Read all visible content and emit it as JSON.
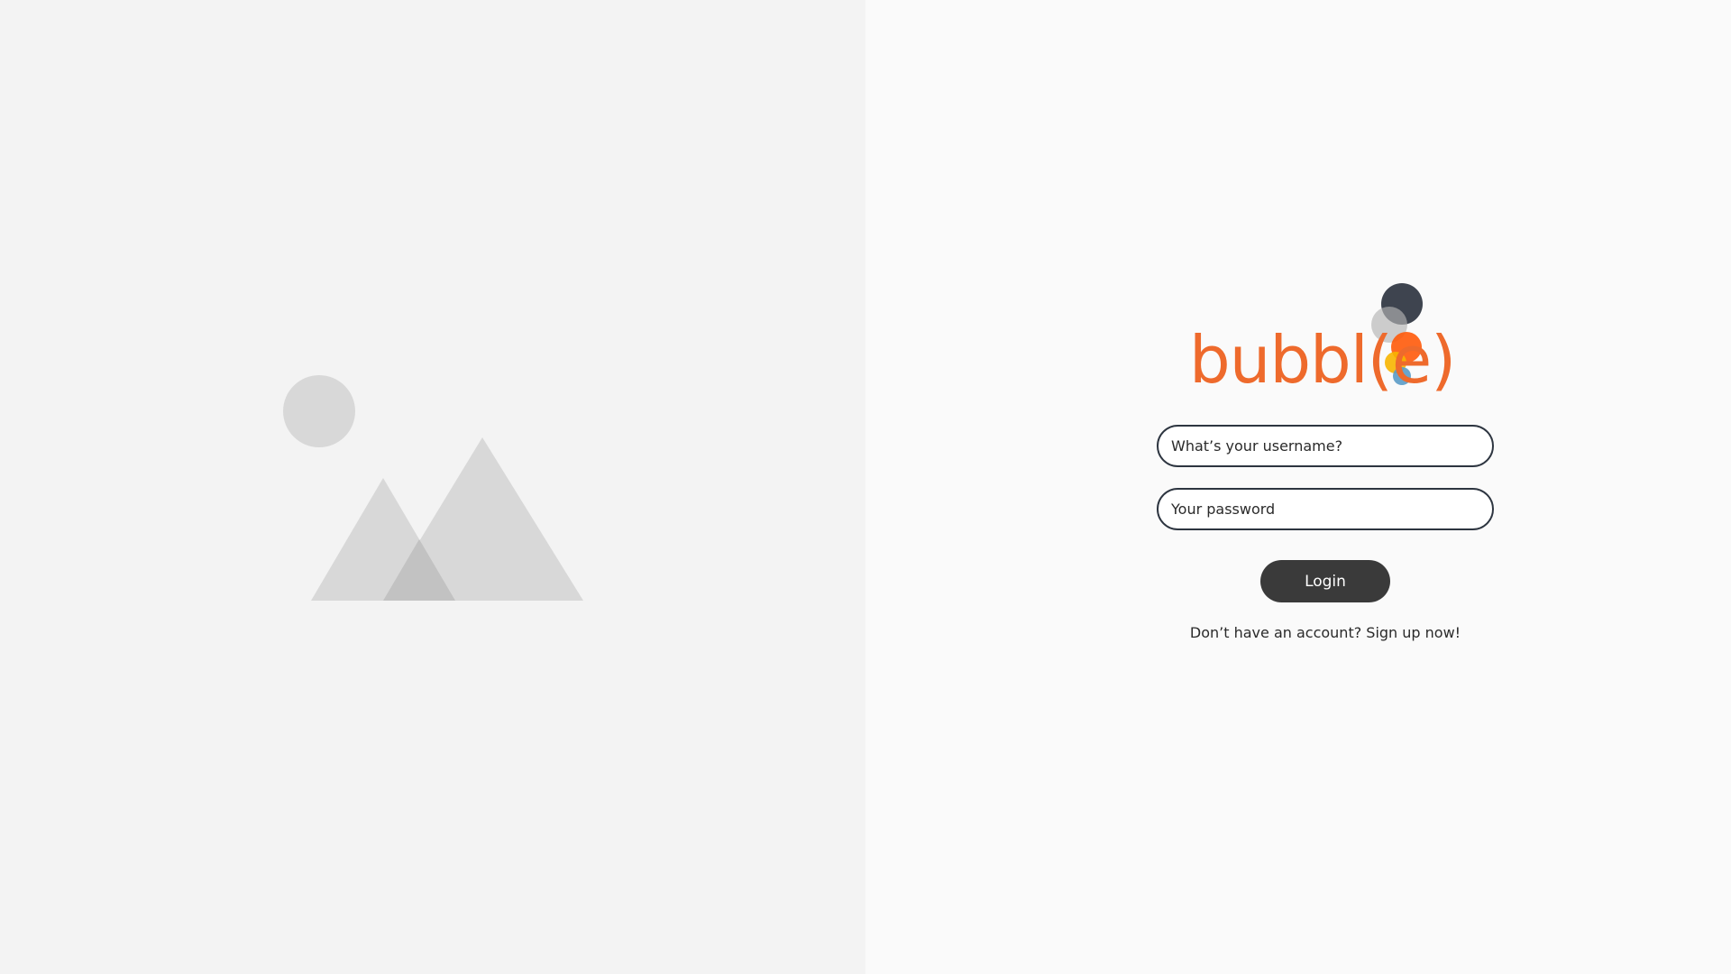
{
  "hero": {
    "icon": "image-placeholder-icon"
  },
  "logo": {
    "text": "bubbl(e)",
    "text_color": "#ee6a2c",
    "bubble_colors": [
      "#2e3440",
      "#b3b3b3",
      "#ff5a0a",
      "#f7b500",
      "#5a9bc7"
    ]
  },
  "form": {
    "username_placeholder": "What’s your username?",
    "password_placeholder": "Your password",
    "login_label": "Login",
    "signup_text": "Don’t have an account? Sign up now!"
  }
}
